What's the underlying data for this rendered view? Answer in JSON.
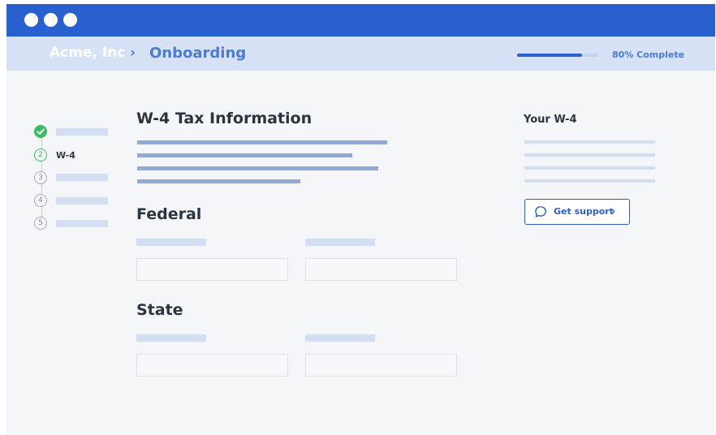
{
  "window": {
    "controls": [
      "close-dot",
      "minimize-dot",
      "maximize-dot"
    ]
  },
  "breadcrumb": {
    "company": "Acme, Inc",
    "separator": "›",
    "current": "Onboarding"
  },
  "progress": {
    "percent": 0.8,
    "label": "80% Complete"
  },
  "stepper": {
    "steps": [
      {
        "number": "",
        "label": "",
        "state": "done"
      },
      {
        "number": "2",
        "label": "W-4",
        "state": "current"
      },
      {
        "number": "3",
        "label": "",
        "state": "upcoming"
      },
      {
        "number": "4",
        "label": "",
        "state": "upcoming"
      },
      {
        "number": "5",
        "label": "",
        "state": "upcoming"
      }
    ]
  },
  "main": {
    "title": "W-4 Tax Information",
    "federal_heading": "Federal",
    "state_heading": "State"
  },
  "side_panel": {
    "title": "Your W-4",
    "support_button_label": "Get support",
    "support_chevron": "›"
  },
  "colors": {
    "titlebar": "#2861cf",
    "breadcrumb_bar": "#d7e2f6",
    "accent": "#4a7bd8",
    "success": "#3dbb61",
    "placeholder": "#d3def3"
  },
  "icons": {
    "done": "check-icon",
    "support": "chat-bubble-icon",
    "support_chevron": "chevron-right-icon"
  }
}
